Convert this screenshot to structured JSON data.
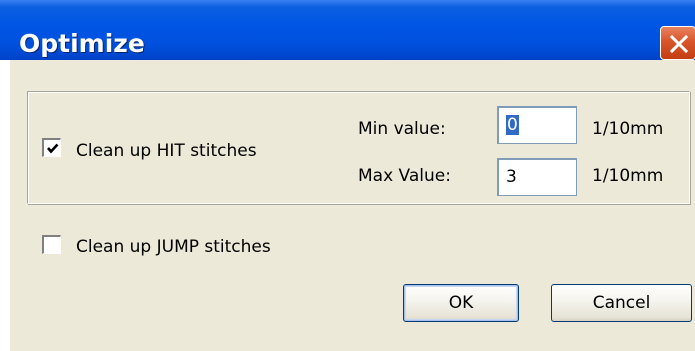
{
  "window": {
    "title": "Optimize"
  },
  "hit": {
    "checkbox_label": "Clean up HIT stitches",
    "checked": true,
    "min_label": "Min value:",
    "min_value": "0",
    "min_unit": "1/10mm",
    "max_label": "Max Value:",
    "max_value": "3",
    "max_unit": "1/10mm"
  },
  "jump": {
    "checkbox_label": "Clean up JUMP stitches",
    "checked": false
  },
  "buttons": {
    "ok_label": "OK",
    "cancel_label": "Cancel"
  },
  "icons": {
    "close": "close-icon",
    "check": "checkmark-icon"
  },
  "colors": {
    "titlebar": "#0055E5",
    "close_button": "#D9542B",
    "dialog_bg": "#ECE9D8",
    "selection": "#316AC5"
  }
}
